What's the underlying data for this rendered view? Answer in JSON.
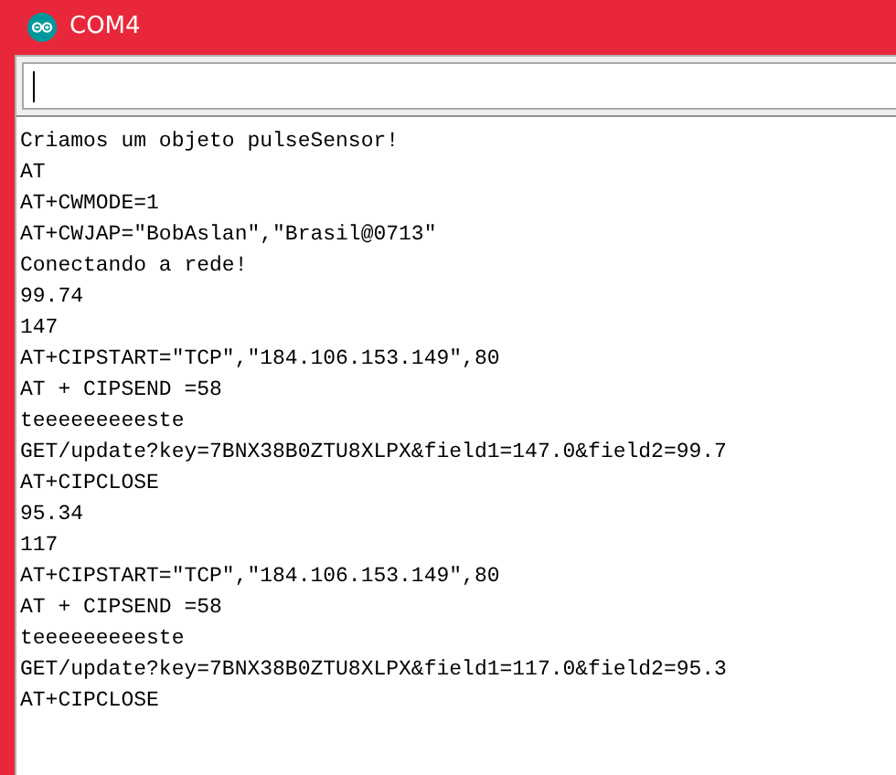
{
  "window": {
    "title": "COM4"
  },
  "send_field": {
    "focused": true
  },
  "output_lines": [
    "Criamos um objeto pulseSensor!",
    "AT",
    "AT+CWMODE=1",
    "AT+CWJAP=\"BobAslan\",\"Brasil@0713\"",
    "Conectando a rede!",
    "99.74",
    "147",
    "AT+CIPSTART=\"TCP\",\"184.106.153.149\",80",
    "AT + CIPSEND =58",
    "teeeeeeeeeste",
    "GET/update?key=7BNX38B0ZTU8XLPX&field1=147.0&field2=99.7",
    "AT+CIPCLOSE",
    "95.34",
    "117",
    "AT+CIPSTART=\"TCP\",\"184.106.153.149\",80",
    "AT + CIPSEND =58",
    "teeeeeeeeeste",
    "GET/update?key=7BNX38B0ZTU8XLPX&field1=117.0&field2=95.3",
    "AT+CIPCLOSE"
  ]
}
